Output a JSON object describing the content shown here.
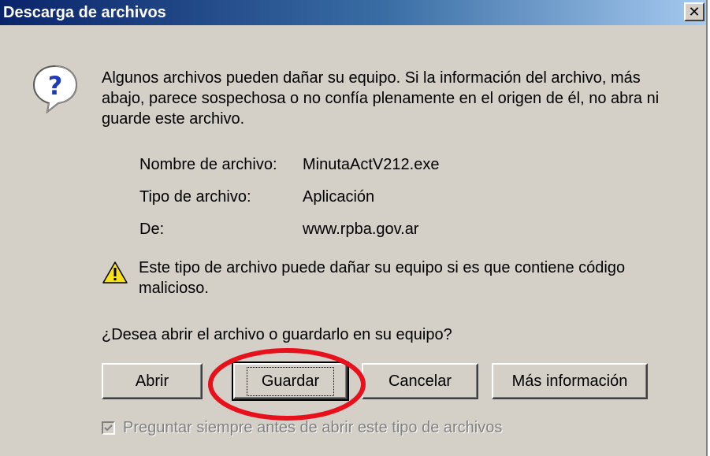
{
  "window": {
    "title": "Descarga de archivos",
    "close_symbol": "✕"
  },
  "icons": {
    "question": "question-icon",
    "warning": "warning-icon",
    "close": "close-icon",
    "check": "checkmark-icon"
  },
  "message": "Algunos archivos pueden dañar su equipo. Si la información del archivo, más abajo, parece sospechosa o no confía plenamente en el origen de él, no abra ni guarde este archivo.",
  "file_info": [
    {
      "label": "Nombre de archivo:",
      "value": "MinutaActV212.exe"
    },
    {
      "label": "Tipo de archivo:",
      "value": "Aplicación"
    },
    {
      "label": "De:",
      "value": "www.rpba.gov.ar"
    }
  ],
  "warning_text": "Este tipo de archivo puede dañar su equipo si es que contiene código malicioso.",
  "question": "¿Desea abrir el archivo o guardarlo en su equipo?",
  "buttons": {
    "open": "Abrir",
    "save": "Guardar",
    "cancel": "Cancelar",
    "more_info": "Más información"
  },
  "checkbox": {
    "label": "Preguntar siempre antes de abrir este tipo de archivos",
    "checked": true,
    "disabled": true
  },
  "colors": {
    "title_bar_start": "#0a246a",
    "title_bar_end": "#a6caf0",
    "dialog_bg": "#d4d0c8",
    "annotation_circle": "#e8101a"
  }
}
